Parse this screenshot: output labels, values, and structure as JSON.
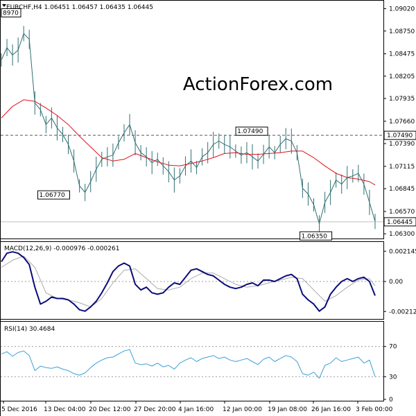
{
  "header": {
    "symbol_line": "EURCHF,H4  1.06451 1.06457 1.06435 1.06445",
    "watermark": "ActionForex.com"
  },
  "colors": {
    "price": "#2f6f73",
    "ma": "#e0101a",
    "macd": "#0b0b7a",
    "signal": "#aaaaaa",
    "rsi": "#3aa0d8",
    "level_line": "#555555",
    "axis": "#000000",
    "watermark": "#cccccc"
  },
  "chart_data": [
    {
      "type": "line",
      "title": "EURCHF,H4",
      "ohlc_label": "1.06451 1.06457 1.06435 1.06445",
      "x_ticks": [
        "5 Dec 2016",
        "13 Dec 04:00",
        "20 Dec 12:00",
        "27 Dec 20:00",
        "4 Jan 16:00",
        "12 Jan 00:00",
        "19 Jan 08:00",
        "26 Jan 16:00",
        "3 Feb 00:00"
      ],
      "y_ticks": [
        "1.09020",
        "1.08750",
        "1.08475",
        "1.08205",
        "1.07935",
        "1.07660",
        "1.07390",
        "1.07115",
        "1.06845",
        "1.06570",
        "1.06300"
      ],
      "ylim": [
        1.0626,
        1.091
      ],
      "current_price_label": "1.06445",
      "current_price": 1.06445,
      "level_label": "1.07490",
      "level": 1.0749,
      "annotations": [
        {
          "text": "8970",
          "x": 0.5,
          "y": 1.0897
        },
        {
          "text": "1.06770",
          "x": 23,
          "y": 1.0677
        },
        {
          "text": "1.07490",
          "x": 94,
          "y": 1.0749
        },
        {
          "text": "1.06350",
          "x": 117,
          "y": 1.0635
        }
      ],
      "series": [
        {
          "x": [
            0,
            2,
            4,
            6,
            8,
            10,
            12,
            14,
            16,
            18,
            20,
            22,
            24,
            26,
            28,
            30,
            32,
            34,
            36,
            38,
            40,
            42,
            44,
            46,
            48,
            50,
            52,
            54,
            56,
            58,
            60,
            62,
            64,
            66,
            68,
            70,
            72,
            74,
            76,
            78,
            80,
            82,
            84,
            86,
            88,
            90,
            92,
            94,
            96,
            98,
            100,
            102,
            104,
            106,
            108,
            110,
            112,
            114,
            116,
            118,
            120,
            122,
            124,
            126,
            128,
            130,
            132,
            134
          ],
          "values": [
            1.084,
            1.0855,
            1.0846,
            1.0852,
            1.0872,
            1.0865,
            1.0788,
            1.078,
            1.0762,
            1.077,
            1.0758,
            1.075,
            1.0738,
            1.0718,
            1.0688,
            1.068,
            1.0693,
            1.0708,
            1.072,
            1.0723,
            1.0725,
            1.074,
            1.0752,
            1.0762,
            1.074,
            1.0728,
            1.0723,
            1.0716,
            1.072,
            1.0712,
            1.0705,
            1.0695,
            1.07,
            1.0712,
            1.0718,
            1.071,
            1.0723,
            1.0728,
            1.0738,
            1.0742,
            1.0738,
            1.0735,
            1.073,
            1.0725,
            1.0728,
            1.0723,
            1.0718,
            1.0726,
            1.0735,
            1.0728,
            1.0738,
            1.0745,
            1.0742,
            1.0728,
            1.0685,
            1.0678,
            1.0665,
            1.0642,
            1.0668,
            1.068,
            1.0695,
            1.069,
            1.0698,
            1.07,
            1.0703,
            1.069,
            1.0668,
            1.0645
          ]
        },
        {
          "x": [
            0,
            4,
            8,
            12,
            16,
            20,
            24,
            28,
            32,
            36,
            40,
            44,
            48,
            52,
            56,
            60,
            64,
            68,
            72,
            76,
            80,
            84,
            88,
            92,
            96,
            100,
            104,
            108,
            112,
            116,
            120,
            124,
            128,
            132,
            134
          ],
          "values": [
            1.077,
            1.0784,
            1.0792,
            1.079,
            1.0782,
            1.0773,
            1.0762,
            1.0748,
            1.0735,
            1.0722,
            1.0718,
            1.072,
            1.0727,
            1.0722,
            1.0717,
            1.0713,
            1.0712,
            1.0715,
            1.0718,
            1.0722,
            1.0727,
            1.0728,
            1.0726,
            1.0726,
            1.0727,
            1.0728,
            1.073,
            1.073,
            1.0722,
            1.0712,
            1.0703,
            1.0698,
            1.0696,
            1.0693,
            1.0689
          ]
        }
      ]
    },
    {
      "type": "line",
      "title": "MACD(12,26,9) -0.000976 -0.000261",
      "y_ticks": [
        "0.002145",
        "0.00",
        "-0.002122"
      ],
      "ylim": [
        -0.0026,
        0.00265
      ],
      "series": [
        {
          "x": [
            0,
            2,
            4,
            6,
            8,
            10,
            12,
            14,
            16,
            18,
            20,
            22,
            24,
            26,
            28,
            30,
            32,
            34,
            36,
            38,
            40,
            42,
            44,
            46,
            48,
            50,
            52,
            54,
            56,
            58,
            60,
            62,
            64,
            66,
            68,
            70,
            72,
            74,
            76,
            78,
            80,
            82,
            84,
            86,
            88,
            90,
            92,
            94,
            96,
            98,
            100,
            102,
            104,
            106,
            108,
            110,
            112,
            114,
            116,
            118,
            120,
            122,
            124,
            126,
            128,
            130,
            132,
            134
          ],
          "values": [
            0.0014,
            0.002,
            0.0021,
            0.002,
            0.0017,
            0.0012,
            -0.0004,
            -0.0016,
            -0.0014,
            -0.0011,
            -0.0012,
            -0.0012,
            -0.0013,
            -0.0016,
            -0.002,
            -0.0021,
            -0.0018,
            -0.0014,
            -0.0008,
            -0.0001,
            0.0007,
            0.0011,
            0.0013,
            0.0011,
            -0.0002,
            -0.0006,
            -0.0004,
            -0.0008,
            -0.0009,
            -0.0008,
            -0.0004,
            -0.0001,
            -0.0002,
            0.0003,
            0.0008,
            0.0009,
            0.0007,
            0.0005,
            0.0004,
            0.0001,
            -0.0002,
            -0.0004,
            -0.0005,
            -0.0004,
            -0.0002,
            -0.0001,
            -0.0003,
            0.0001,
            0.0001,
            0.0,
            0.0002,
            0.0004,
            0.0005,
            0.0002,
            -0.0009,
            -0.0013,
            -0.0016,
            -0.0021,
            -0.0018,
            -0.0009,
            -0.0004,
            0.0,
            0.0002,
            0.0,
            0.0002,
            0.0003,
            0.0,
            -0.001
          ]
        },
        {
          "x": [
            0,
            4,
            8,
            12,
            16,
            20,
            24,
            28,
            32,
            36,
            40,
            44,
            48,
            52,
            56,
            60,
            64,
            68,
            72,
            76,
            80,
            84,
            88,
            92,
            96,
            100,
            104,
            108,
            112,
            116,
            120,
            124,
            128,
            132,
            134
          ],
          "values": [
            0.001,
            0.0015,
            0.0018,
            0.001,
            -0.0008,
            -0.0012,
            -0.0013,
            -0.0015,
            -0.0018,
            -0.0012,
            -0.0001,
            0.0008,
            0.0009,
            0.0002,
            -0.0005,
            -0.0006,
            -0.0004,
            0.0002,
            0.0006,
            0.0006,
            0.0002,
            -0.0002,
            -0.0004,
            -0.0003,
            -0.0001,
            0.0001,
            0.0003,
            0.0002,
            -0.0006,
            -0.0014,
            -0.001,
            -0.0004,
            0.0001,
            0.0002,
            -0.0003
          ]
        }
      ]
    },
    {
      "type": "line",
      "title": "RSI(14) 30.4684",
      "y_ticks": [
        "100",
        "70",
        "30",
        "0"
      ],
      "ylim": [
        0,
        100
      ],
      "levels": [
        70,
        30
      ],
      "series": [
        {
          "x": [
            0,
            2,
            4,
            6,
            8,
            10,
            12,
            14,
            16,
            18,
            20,
            22,
            24,
            26,
            28,
            30,
            32,
            34,
            36,
            38,
            40,
            42,
            44,
            46,
            48,
            50,
            52,
            54,
            56,
            58,
            60,
            62,
            64,
            66,
            68,
            70,
            72,
            74,
            76,
            78,
            80,
            82,
            84,
            86,
            88,
            90,
            92,
            94,
            96,
            98,
            100,
            102,
            104,
            106,
            108,
            110,
            112,
            114,
            116,
            118,
            120,
            122,
            124,
            126,
            128,
            130,
            132,
            134
          ],
          "values": [
            60,
            63,
            57,
            62,
            64,
            58,
            38,
            44,
            42,
            41,
            43,
            40,
            38,
            34,
            32,
            35,
            42,
            48,
            52,
            55,
            56,
            60,
            64,
            66,
            48,
            46,
            47,
            44,
            48,
            43,
            45,
            40,
            48,
            52,
            55,
            50,
            54,
            56,
            58,
            54,
            56,
            52,
            50,
            52,
            54,
            50,
            46,
            53,
            56,
            50,
            54,
            58,
            56,
            50,
            34,
            32,
            36,
            28,
            45,
            48,
            55,
            50,
            52,
            54,
            56,
            48,
            52,
            30
          ]
        }
      ]
    }
  ]
}
